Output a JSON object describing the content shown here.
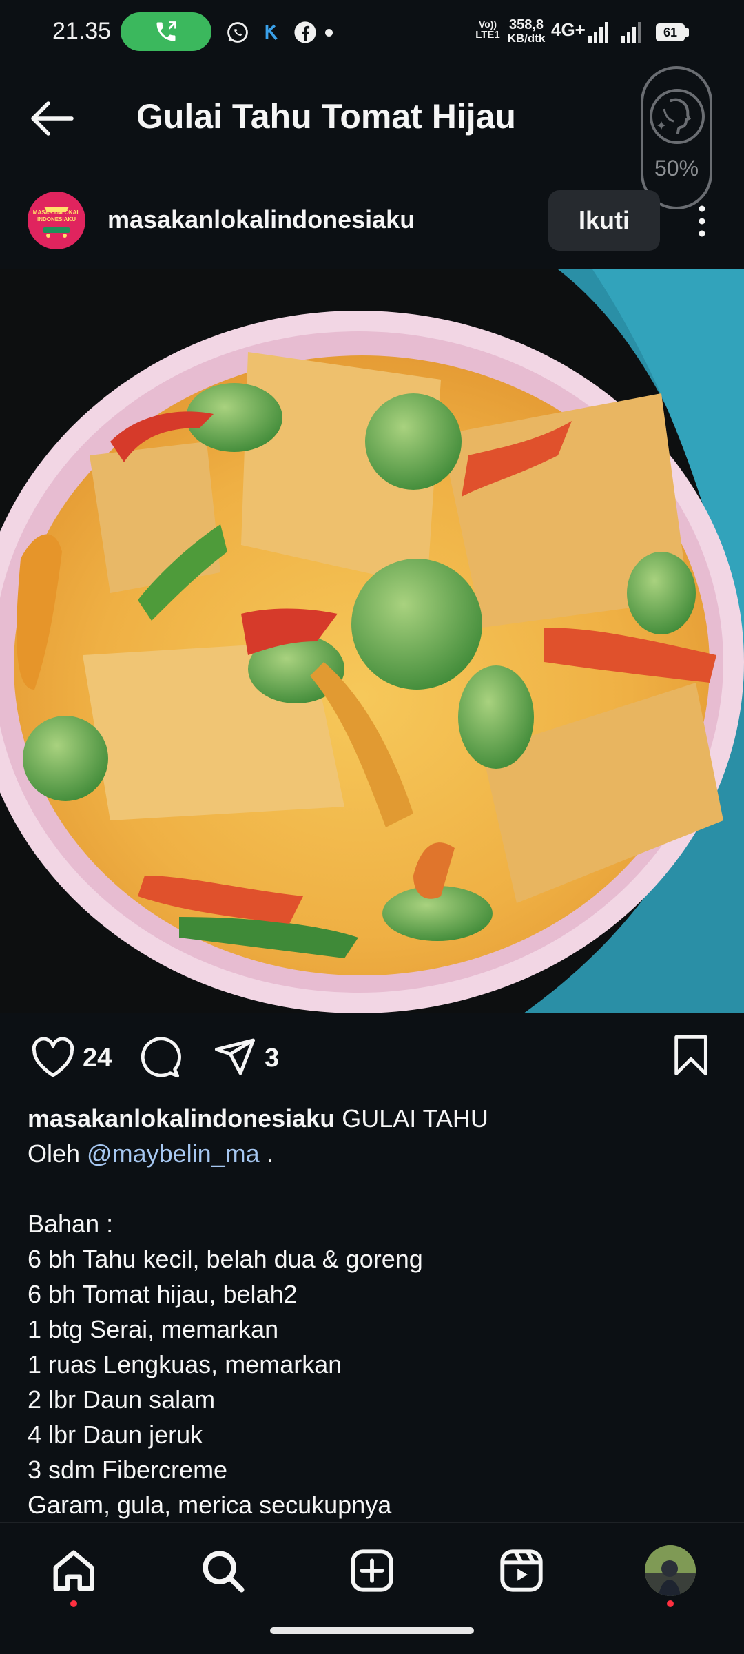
{
  "status_bar": {
    "time": "21.35",
    "network_top": "Vo))",
    "network_bottom": "LTE1",
    "speed_value": "358,8",
    "speed_unit": "KB/dtk",
    "network_type": "4G+",
    "battery": "61"
  },
  "header": {
    "title": "Gulai Tahu Tomat Hijau"
  },
  "overlay": {
    "percent": "50%"
  },
  "profile": {
    "username": "masakanlokalindonesiaku",
    "avatar_logo_line1": "MASAKANLOKAL",
    "avatar_logo_line2": "INDONESIAKU",
    "follow_label": "Ikuti"
  },
  "post_image": {
    "icon": "food-photo"
  },
  "actions": {
    "likes": "24",
    "shares": "3"
  },
  "caption": {
    "username": "masakanlokalindonesiaku",
    "title": " GULAI TAHU",
    "by_prefix": "Oleh ",
    "mention": "@maybelin_ma",
    "by_suffix": " .",
    "ingredients_heading": "Bahan :",
    "ingredients": [
      "6 bh Tahu kecil, belah dua & goreng",
      "6 bh Tomat hijau, belah2",
      "1 btg Serai, memarkan",
      "1 ruas Lengkuas, memarkan",
      "2 lbr Daun salam",
      "4 lbr Daun jeruk",
      "3 sdm Fibercreme",
      "Garam, gula, merica secukupnya"
    ]
  },
  "colors": {
    "background": "#0c1014",
    "accent_link": "#a7c8f2",
    "call_pill": "#3bb85d",
    "notification_dot": "#ff3040"
  }
}
